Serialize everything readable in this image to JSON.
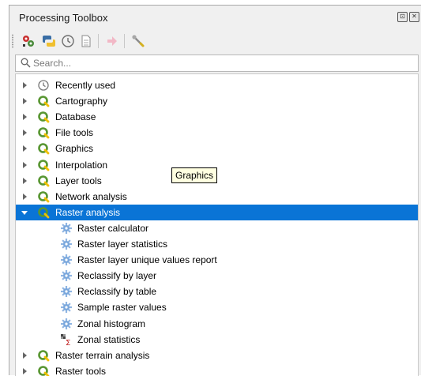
{
  "panel": {
    "title": "Processing Toolbox",
    "title_buttons": [
      "float-icon",
      "close-icon"
    ]
  },
  "toolbar": {
    "buttons": [
      {
        "name": "models-button",
        "icon": "models-icon"
      },
      {
        "name": "python-scripts-button",
        "icon": "python-icon"
      },
      {
        "name": "history-button",
        "icon": "history-clock-icon"
      },
      {
        "name": "results-viewer-button",
        "icon": "results-document-icon"
      },
      {
        "name": "edit-features-in-place-button",
        "icon": "edit-in-place-icon"
      },
      {
        "name": "options-button",
        "icon": "wrench-icon"
      }
    ]
  },
  "search": {
    "placeholder": "Search..."
  },
  "tooltip": {
    "text": "Graphics"
  },
  "tree": {
    "items": [
      {
        "label": "Recently used",
        "icon": "clock-icon",
        "expanded": false
      },
      {
        "label": "Cartography",
        "icon": "qgis-provider-icon",
        "expanded": false
      },
      {
        "label": "Database",
        "icon": "qgis-provider-icon",
        "expanded": false
      },
      {
        "label": "File tools",
        "icon": "qgis-provider-icon",
        "expanded": false
      },
      {
        "label": "Graphics",
        "icon": "qgis-provider-icon",
        "expanded": false
      },
      {
        "label": "Interpolation",
        "icon": "qgis-provider-icon",
        "expanded": false
      },
      {
        "label": "Layer tools",
        "icon": "qgis-provider-icon",
        "expanded": false
      },
      {
        "label": "Network analysis",
        "icon": "qgis-provider-icon",
        "expanded": false
      },
      {
        "label": "Raster analysis",
        "icon": "qgis-provider-icon",
        "expanded": true,
        "selected": true
      },
      {
        "label": "Raster calculator",
        "icon": "algorithm-gear-icon",
        "child": true
      },
      {
        "label": "Raster layer statistics",
        "icon": "algorithm-gear-icon",
        "child": true
      },
      {
        "label": "Raster layer unique values report",
        "icon": "algorithm-gear-icon",
        "child": true
      },
      {
        "label": "Reclassify by layer",
        "icon": "algorithm-gear-icon",
        "child": true
      },
      {
        "label": "Reclassify by table",
        "icon": "algorithm-gear-icon",
        "child": true
      },
      {
        "label": "Sample raster values",
        "icon": "algorithm-gear-icon",
        "child": true
      },
      {
        "label": "Zonal histogram",
        "icon": "algorithm-gear-icon",
        "child": true
      },
      {
        "label": "Zonal statistics",
        "icon": "zonal-statistics-icon",
        "child": true
      },
      {
        "label": "Raster terrain analysis",
        "icon": "qgis-provider-icon",
        "expanded": false
      },
      {
        "label": "Raster tools",
        "icon": "qgis-provider-icon",
        "expanded": false
      }
    ]
  },
  "colors": {
    "selection": "#0a74d6",
    "qgis_green": "#589632",
    "gear_blue": "#7aa7dc",
    "tooltip_bg": "#ffffe1"
  }
}
